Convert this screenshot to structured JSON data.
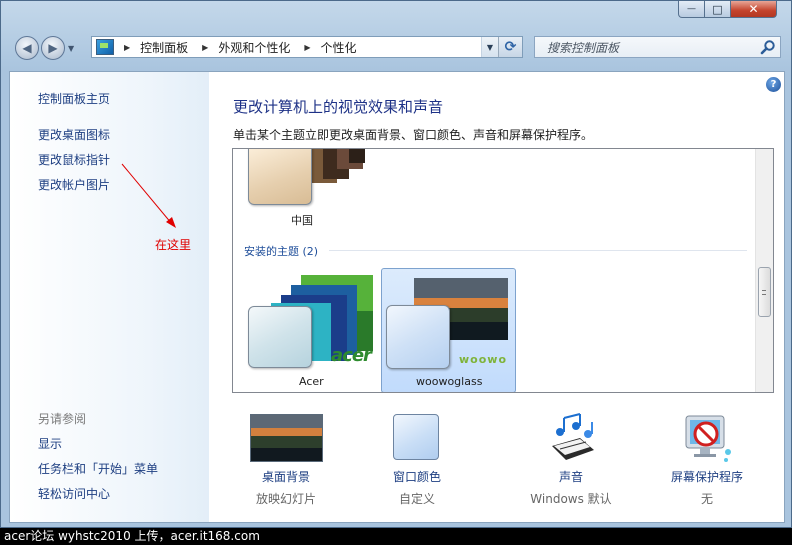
{
  "window": {
    "caption_buttons": {
      "minimize": "—",
      "maximize": "□",
      "close": "✕"
    }
  },
  "address_bar": {
    "crumbs": [
      "控制面板",
      "外观和个性化",
      "个性化"
    ]
  },
  "search": {
    "placeholder": "搜索控制面板"
  },
  "sidebar": {
    "home": "控制面板主页",
    "links": [
      "更改桌面图标",
      "更改鼠标指针",
      "更改帐户图片"
    ],
    "see_also_label": "另请参阅",
    "see_also": [
      "显示",
      "任务栏和「开始」菜单",
      "轻松访问中心"
    ]
  },
  "annotation": {
    "text": "在这里",
    "color": "#e00000"
  },
  "main": {
    "title": "更改计算机上的视觉效果和声音",
    "subtitle": "单击某个主题立即更改桌面背景、窗口颜色、声音和屏幕保护程序。",
    "themes": {
      "top_theme": "中国",
      "installed_group": "安装的主题 (2)",
      "installed": [
        {
          "name": "Acer",
          "brand": "acer",
          "selected": false
        },
        {
          "name": "woowoglass",
          "brand": "woowo",
          "selected": true
        }
      ]
    },
    "settings": [
      {
        "label": "桌面背景",
        "value": "放映幻灯片",
        "icon": "desktop-background-icon"
      },
      {
        "label": "窗口颜色",
        "value": "自定义",
        "icon": "window-color-icon"
      },
      {
        "label": "声音",
        "value": "Windows 默认",
        "icon": "sound-icon"
      },
      {
        "label": "屏幕保护程序",
        "value": "无",
        "icon": "screensaver-icon"
      }
    ]
  },
  "footer_watermark": "acer论坛 wyhstc2010 上传，acer.it168.com",
  "colors": {
    "link": "#1e3f82",
    "title": "#1e3287",
    "accent": "#2e8b2e"
  }
}
